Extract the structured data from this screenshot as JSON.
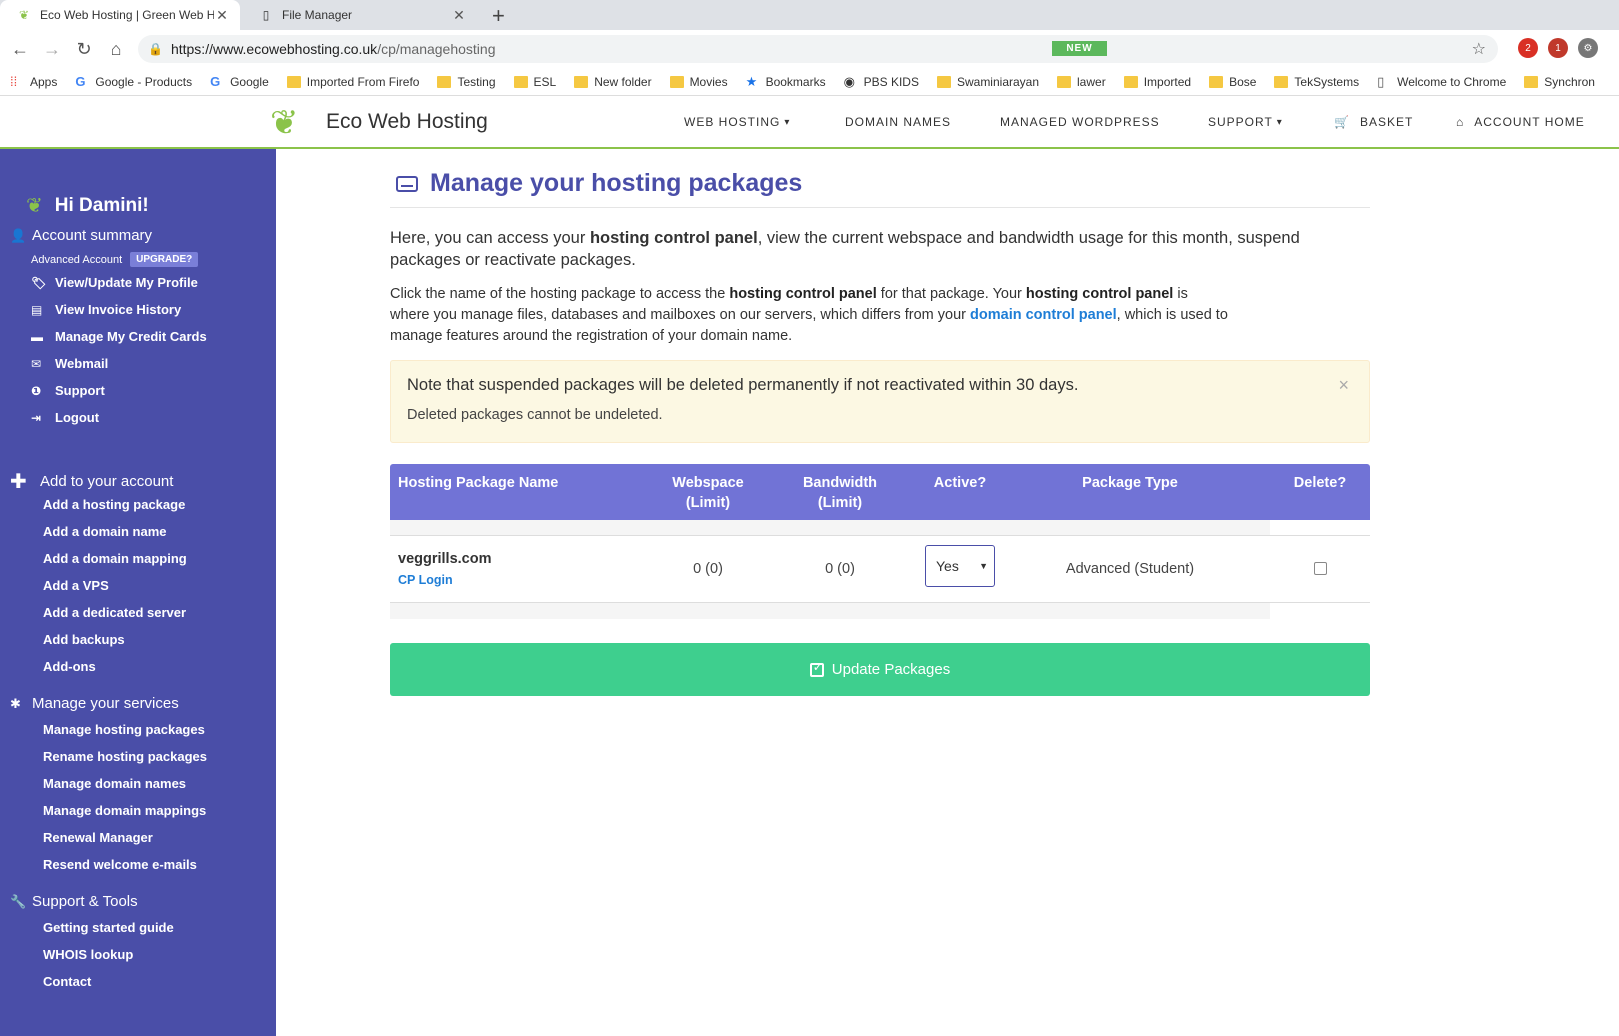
{
  "browser": {
    "tabs": [
      {
        "title": "Eco Web Hosting | Green Web Ho",
        "active": true
      },
      {
        "title": "File Manager",
        "active": false
      }
    ],
    "url_host": "https://www.ecowebhosting.co.uk",
    "url_path": "/cp/managehosting",
    "extensions": [
      {
        "badge": "2",
        "color": "#d93025"
      },
      {
        "badge": "1",
        "color": "#c0392b"
      }
    ],
    "bookmarks": [
      {
        "label": "Apps",
        "icon": "apps-grid-icon"
      },
      {
        "label": "Google - Products",
        "icon": "google-icon"
      },
      {
        "label": "Google",
        "icon": "google-icon"
      },
      {
        "label": "Imported From Firefo",
        "icon": "folder-icon"
      },
      {
        "label": "Testing",
        "icon": "folder-icon"
      },
      {
        "label": "ESL",
        "icon": "folder-icon"
      },
      {
        "label": "New folder",
        "icon": "folder-icon"
      },
      {
        "label": "Movies",
        "icon": "folder-icon"
      },
      {
        "label": "Bookmarks",
        "icon": "star-icon"
      },
      {
        "label": "PBS KIDS",
        "icon": "pbs-icon"
      },
      {
        "label": "Swaminiarayan",
        "icon": "folder-icon"
      },
      {
        "label": "lawer",
        "icon": "folder-icon"
      },
      {
        "label": "Imported",
        "icon": "folder-icon"
      },
      {
        "label": "Bose",
        "icon": "folder-icon"
      },
      {
        "label": "TekSystems",
        "icon": "folder-icon"
      },
      {
        "label": "Welcome to Chrome",
        "icon": "page-icon"
      },
      {
        "label": "Synchron",
        "icon": "folder-icon"
      }
    ]
  },
  "header": {
    "brand": "Eco Web Hosting",
    "nav": {
      "web_hosting": "WEB HOSTING",
      "domain_names": "DOMAIN NAMES",
      "managed_wordpress": "MANAGED WORDPRESS",
      "support": "SUPPORT",
      "basket": "BASKET",
      "account_home": "ACCOUNT HOME"
    },
    "new_badge": "NEW",
    "accent": "#8bc34a"
  },
  "sidebar": {
    "greeting": "Hi Damini!",
    "account_summary": "Account summary",
    "account_type": "Advanced Account",
    "upgrade": "UPGRADE?",
    "account_items": [
      "View/Update My Profile",
      "View Invoice History",
      "Manage My Credit Cards",
      "Webmail",
      "Support",
      "Logout"
    ],
    "add_title": "Add to your account",
    "add_items": [
      "Add a hosting package",
      "Add a domain name",
      "Add a domain mapping",
      "Add a VPS",
      "Add a dedicated server",
      "Add backups",
      "Add-ons"
    ],
    "manage_title": "Manage your services",
    "manage_items": [
      "Manage hosting packages",
      "Rename hosting packages",
      "Manage domain names",
      "Manage domain mappings",
      "Renewal Manager",
      "Resend welcome e-mails"
    ],
    "tools_title": "Support & Tools",
    "tools_items": [
      "Getting started guide",
      "WHOIS lookup",
      "Contact"
    ],
    "bg_color": "#4a4ea8"
  },
  "main": {
    "title": "Manage your hosting packages",
    "lead_pre": "Here, you can access your ",
    "lead_bold": "hosting control panel",
    "lead_post": ", view the current webspace and bandwidth usage for this month, suspend packages or reactivate packages.",
    "para_1": "Click the name of the hosting package to access the ",
    "para_bold_1": "hosting control panel",
    "para_2": " for that package. Your ",
    "para_bold_2": "hosting control panel",
    "para_3": " is where you manage files, databases and mailboxes on our servers, which differs from your ",
    "para_link": "domain control panel",
    "para_4": ", which is used to manage features around the registration of your domain name.",
    "alert_line1": "Note that suspended packages will be deleted permanently if not reactivated within 30 days.",
    "alert_line2": "Deleted packages cannot be undeleted.",
    "alert_close": "×",
    "table": {
      "headers": {
        "name": "Hosting Package Name",
        "webspace_1": "Webspace",
        "webspace_2": "(Limit)",
        "bandwidth_1": "Bandwidth",
        "bandwidth_2": "(Limit)",
        "active": "Active?",
        "type": "Package Type",
        "delete": "Delete?"
      },
      "rows": [
        {
          "name": "veggrills.com",
          "cp_login": "CP Login",
          "webspace": "0 (0)",
          "bandwidth": "0 (0)",
          "active": "Yes",
          "type": "Advanced (Student)",
          "delete_checked": false
        }
      ]
    },
    "update_button": "Update Packages",
    "title_color": "#4a4ea8",
    "button_color": "#3ecf8e"
  }
}
